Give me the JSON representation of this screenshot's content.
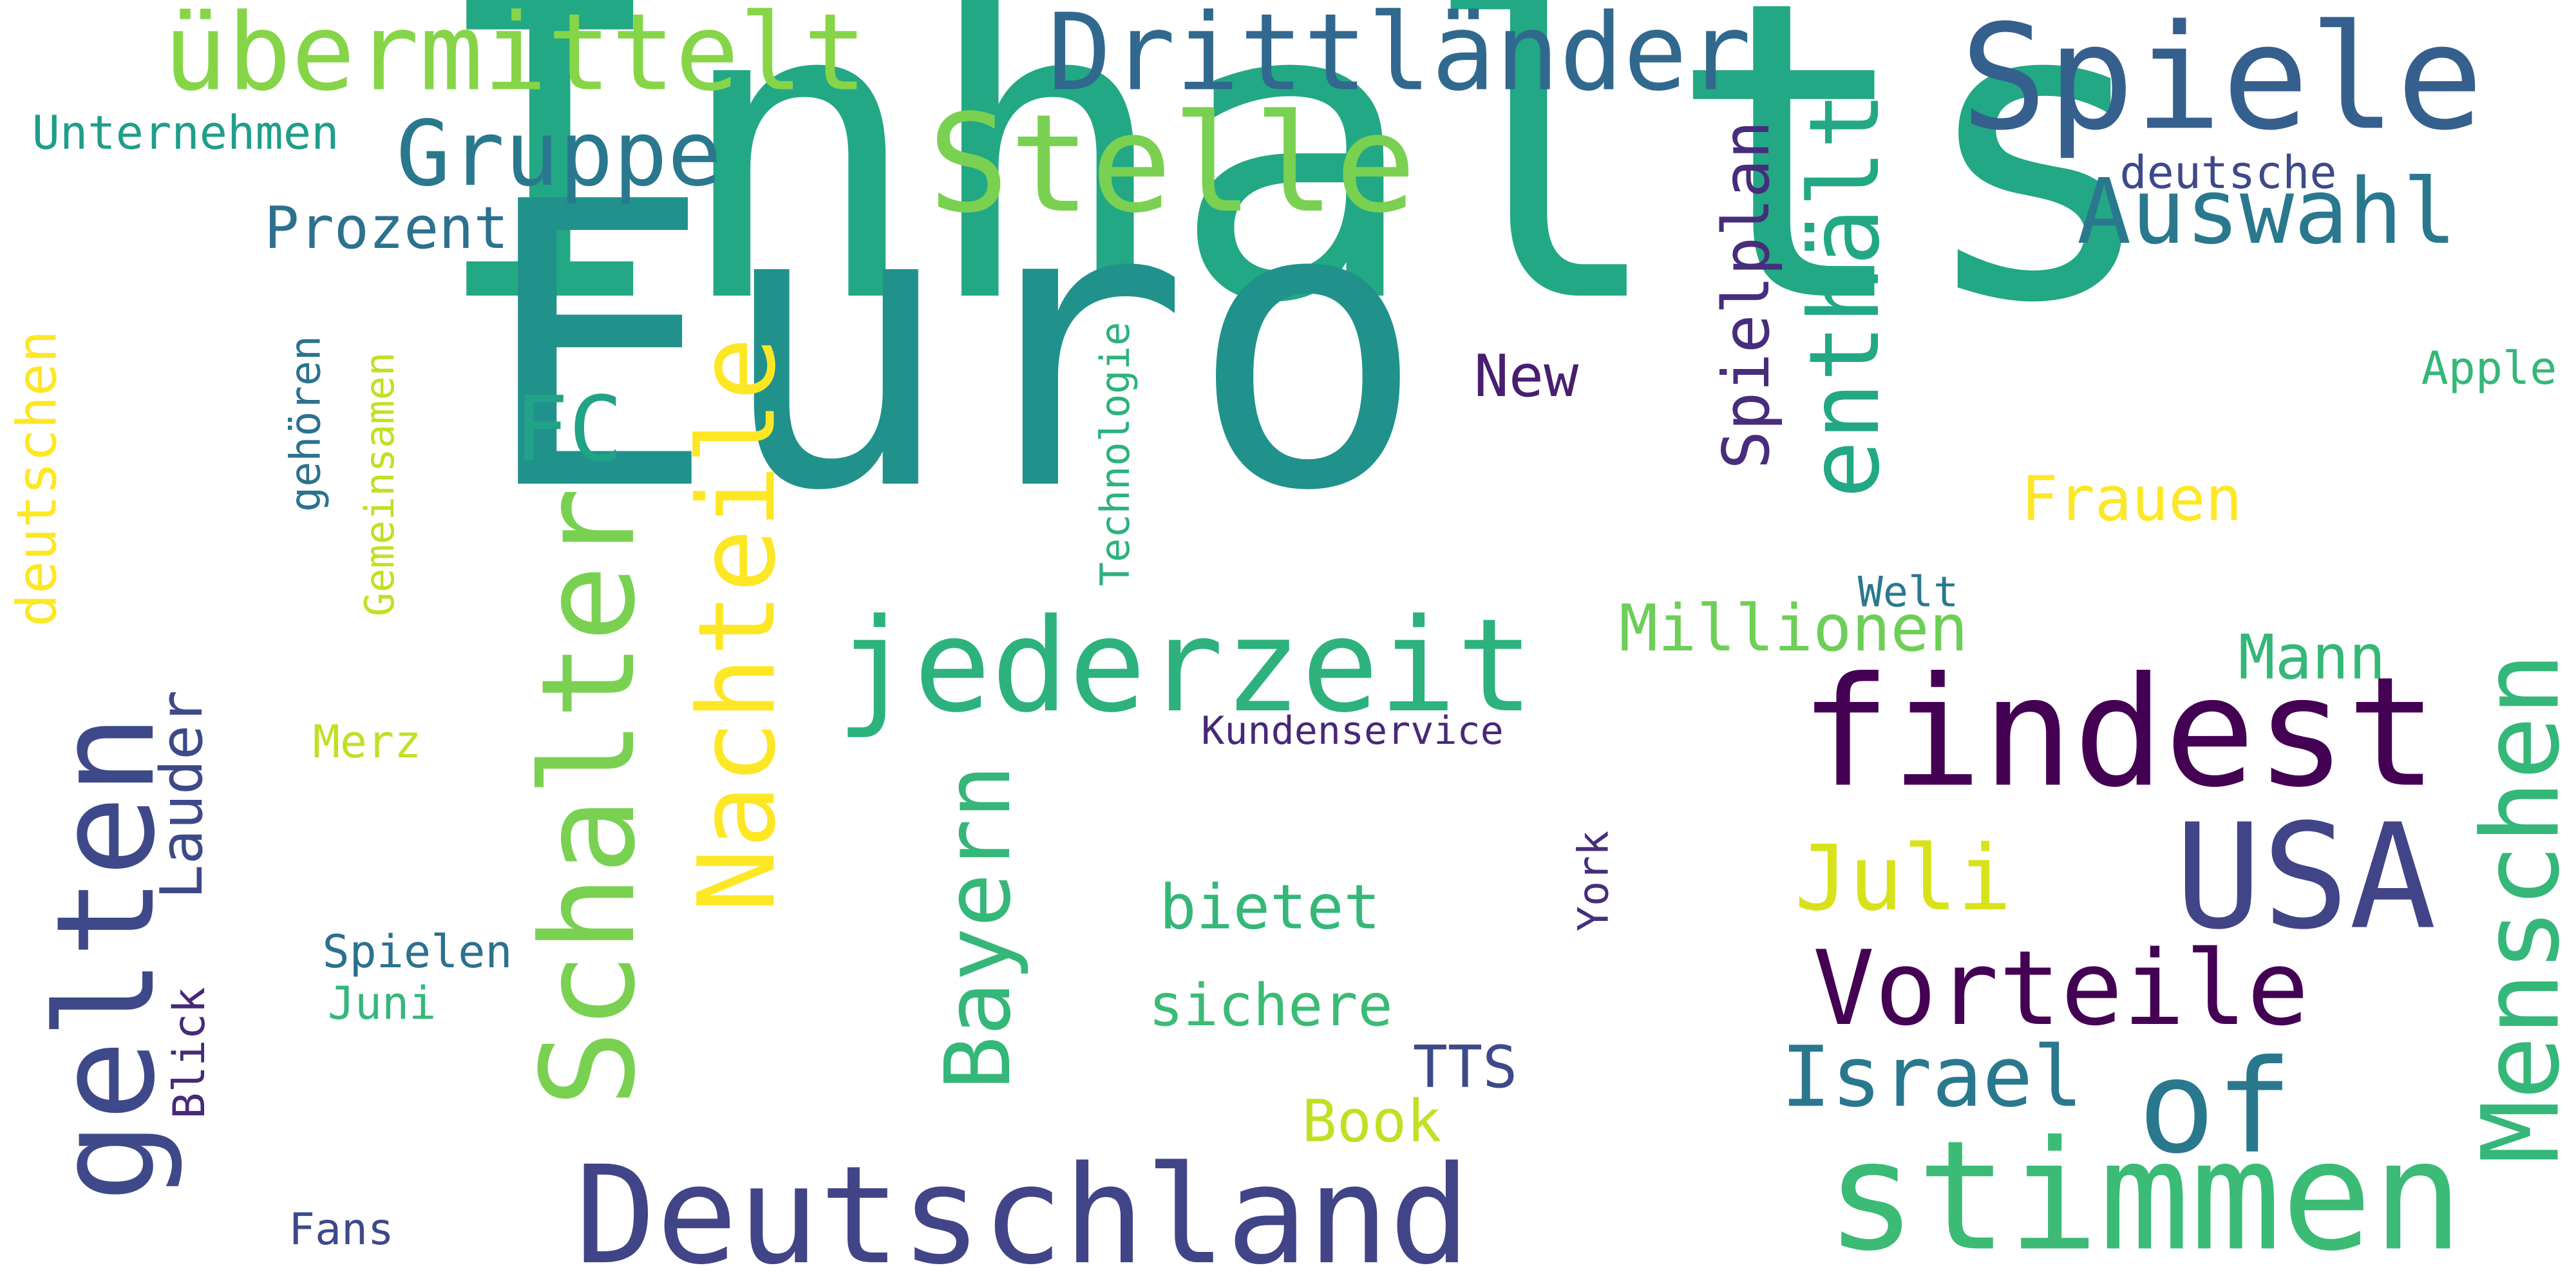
{
  "words": [
    {
      "key": "inhalts",
      "text": "Inhalts",
      "color": "#22a884"
    },
    {
      "key": "euro",
      "text": "Euro",
      "color": "#21918c"
    },
    {
      "key": "stimmen",
      "text": "stimmen",
      "color": "#3bbb75"
    },
    {
      "key": "deutschland",
      "text": "Deutschland",
      "color": "#414487"
    },
    {
      "key": "findest",
      "text": "findest",
      "color": "#440154"
    },
    {
      "key": "gelten",
      "text": "gelten",
      "color": "#3e4989"
    },
    {
      "key": "schalter",
      "text": "Schalter",
      "color": "#7ad151"
    },
    {
      "key": "nachteile",
      "text": "Nachteile",
      "color": "#fde725"
    },
    {
      "key": "menschen",
      "text": "Menschen",
      "color": "#35b779"
    },
    {
      "key": "usa",
      "text": "USA",
      "color": "#414487"
    },
    {
      "key": "spiele",
      "text": "Spiele",
      "color": "#355f8d"
    },
    {
      "key": "stelle",
      "text": "Stelle",
      "color": "#7ad151"
    },
    {
      "key": "jederzeit",
      "text": "jederzeit",
      "color": "#2db27d"
    },
    {
      "key": "drittlaender",
      "text": "Drittländer",
      "color": "#31688e"
    },
    {
      "key": "uebermittelt",
      "text": "übermittelt",
      "color": "#86d549"
    },
    {
      "key": "vorteile",
      "text": "Vorteile",
      "color": "#440154"
    },
    {
      "key": "of",
      "text": "of",
      "color": "#2a788e"
    },
    {
      "key": "enthaelt",
      "text": "enthält",
      "color": "#22a884"
    },
    {
      "key": "gruppe",
      "text": "Gruppe",
      "color": "#2a788e"
    },
    {
      "key": "auswahl",
      "text": "Auswahl",
      "color": "#2a788e"
    },
    {
      "key": "bayern",
      "text": "Bayern",
      "color": "#35b779"
    },
    {
      "key": "israel",
      "text": "Israel",
      "color": "#2a788e"
    },
    {
      "key": "juli",
      "text": "Juli",
      "color": "#d8e219"
    },
    {
      "key": "fc",
      "text": "FC",
      "color": "#20a386"
    },
    {
      "key": "millionen",
      "text": "Millionen",
      "color": "#6ece58"
    },
    {
      "key": "spielplan",
      "text": "Spielplan",
      "color": "#472d7b"
    },
    {
      "key": "lauder",
      "text": "Lauder",
      "color": "#3e4989"
    },
    {
      "key": "prozent",
      "text": "Prozent",
      "color": "#2c718e"
    },
    {
      "key": "frauen",
      "text": "Frauen",
      "color": "#fde725"
    },
    {
      "key": "mann",
      "text": "Mann",
      "color": "#35b779"
    },
    {
      "key": "deutschen",
      "text": "deutschen",
      "color": "#fde725"
    },
    {
      "key": "bietet",
      "text": "bietet",
      "color": "#35b779"
    },
    {
      "key": "sichere",
      "text": "sichere",
      "color": "#3bbb75"
    },
    {
      "key": "book",
      "text": "Book",
      "color": "#c2df23"
    },
    {
      "key": "tts",
      "text": "TTS",
      "color": "#3e4989"
    },
    {
      "key": "new",
      "text": "New",
      "color": "#481f70"
    },
    {
      "key": "unternehmen",
      "text": "Unternehmen",
      "color": "#1f9e89"
    },
    {
      "key": "deutsche",
      "text": "deutsche",
      "color": "#3e4989"
    },
    {
      "key": "apple",
      "text": "Apple",
      "color": "#35b779"
    },
    {
      "key": "technologie",
      "text": "Technologie",
      "color": "#2db27d"
    },
    {
      "key": "gemeinsamen",
      "text": "Gemeinsamen",
      "color": "#c2df23"
    },
    {
      "key": "gehoeren",
      "text": "gehören",
      "color": "#2c728e"
    },
    {
      "key": "spielen",
      "text": "Spielen",
      "color": "#2c718e"
    },
    {
      "key": "juni",
      "text": "Juni",
      "color": "#35b779"
    },
    {
      "key": "merz",
      "text": "Merz",
      "color": "#c2df23"
    },
    {
      "key": "kundenservice",
      "text": "Kundenservice",
      "color": "#482878"
    },
    {
      "key": "welt",
      "text": "Welt",
      "color": "#2a788e"
    },
    {
      "key": "york",
      "text": "York",
      "color": "#472d7b"
    },
    {
      "key": "blick",
      "text": "Blick",
      "color": "#482878"
    },
    {
      "key": "fans",
      "text": "Fans",
      "color": "#3e4989"
    }
  ]
}
